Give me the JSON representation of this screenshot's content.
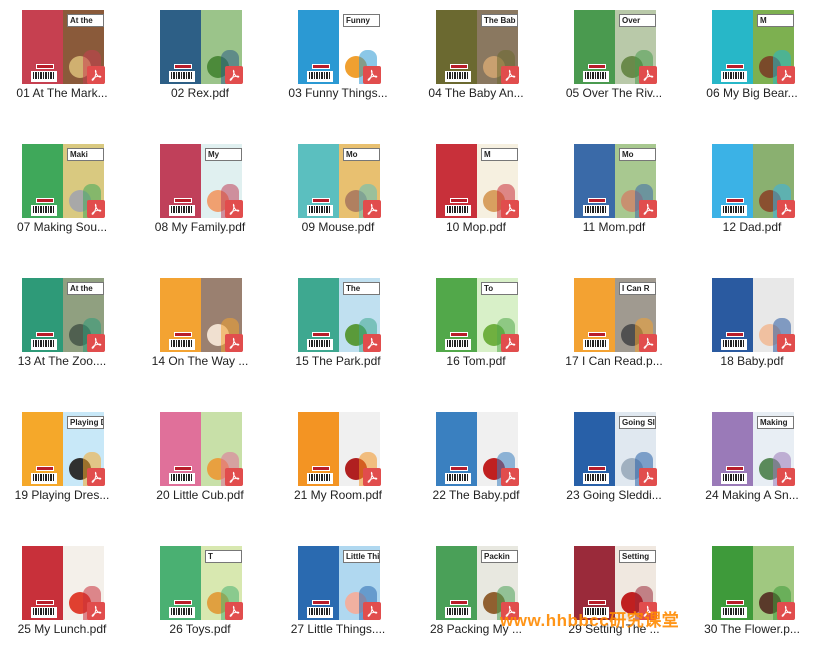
{
  "files": [
    {
      "label": "01 At The Mark...",
      "cover_title": "At the",
      "spine": "#c64050",
      "cover": "#8a5a3a",
      "accent": "#d0b070"
    },
    {
      "label": "02 Rex.pdf",
      "cover_title": "",
      "spine": "#2d5f86",
      "cover": "#9bc48a",
      "accent": "#4c8a3a"
    },
    {
      "label": "03 Funny Things...",
      "cover_title": "Funny",
      "spine": "#2b99d3",
      "cover": "#ffffff",
      "accent": "#f0a030"
    },
    {
      "label": "04 The Baby An...",
      "cover_title": "The Bab",
      "spine": "#6b6930",
      "cover": "#8a7860",
      "accent": "#c9a070"
    },
    {
      "label": "05 Over The Riv...",
      "cover_title": "Over",
      "spine": "#4a9a4f",
      "cover": "#b9c9a9",
      "accent": "#6a8a4a"
    },
    {
      "label": "06 My Big Bear...",
      "cover_title": "M",
      "spine": "#27b7c8",
      "cover": "#7db050",
      "accent": "#7a4a2a"
    },
    {
      "label": "07 Making Sou...",
      "cover_title": "Maki",
      "spine": "#3fa85a",
      "cover": "#d9c980",
      "accent": "#a8a8a8"
    },
    {
      "label": "08 My Family.pdf",
      "cover_title": "My",
      "spine": "#c0405a",
      "cover": "#e0f0f0",
      "accent": "#f0a070"
    },
    {
      "label": "09 Mouse.pdf",
      "cover_title": "Mo",
      "spine": "#5bbfbf",
      "cover": "#e8c070",
      "accent": "#b08060"
    },
    {
      "label": "10 Mop.pdf",
      "cover_title": "M",
      "spine": "#c8303a",
      "cover": "#f6f0e0",
      "accent": "#d8a060"
    },
    {
      "label": "11 Mom.pdf",
      "cover_title": "Mo",
      "spine": "#3a6aa8",
      "cover": "#a8c890",
      "accent": "#c89070"
    },
    {
      "label": "12 Dad.pdf",
      "cover_title": "",
      "spine": "#3bb2e6",
      "cover": "#8ab070",
      "accent": "#8a5030"
    },
    {
      "label": "13 At The Zoo....",
      "cover_title": "At the",
      "spine": "#2e9a78",
      "cover": "#90a080",
      "accent": "#506050"
    },
    {
      "label": "14 On The Way ...",
      "cover_title": "",
      "spine": "#f3a332",
      "cover": "#9a8070",
      "accent": "#f0e0d0"
    },
    {
      "label": "15 The Park.pdf",
      "cover_title": "The",
      "spine": "#3ea890",
      "cover": "#c0e0f0",
      "accent": "#5a9a3a"
    },
    {
      "label": "16 Tom.pdf",
      "cover_title": "To",
      "spine": "#52a84a",
      "cover": "#d8f0c8",
      "accent": "#70b040"
    },
    {
      "label": "17 I Can Read.p...",
      "cover_title": "I Can R",
      "spine": "#f3a232",
      "cover": "#a09a90",
      "accent": "#505050"
    },
    {
      "label": "18 Baby.pdf",
      "cover_title": "",
      "spine": "#2a5aa0",
      "cover": "#e8e8e8",
      "accent": "#f0c0a0"
    },
    {
      "label": "19 Playing Dres...",
      "cover_title": "Playing Dress Up",
      "spine": "#f5a82a",
      "cover": "#c8e8f8",
      "accent": "#303030"
    },
    {
      "label": "20 Little Cub.pdf",
      "cover_title": "",
      "spine": "#e0709a",
      "cover": "#c8e0a8",
      "accent": "#e8a040"
    },
    {
      "label": "21 My Room.pdf",
      "cover_title": "",
      "spine": "#f39423",
      "cover": "#f0f0f0",
      "accent": "#b02020"
    },
    {
      "label": "22 The Baby.pdf",
      "cover_title": "",
      "spine": "#3a80c0",
      "cover": "#f0f0f0",
      "accent": "#c02020"
    },
    {
      "label": "23 Going Sleddi...",
      "cover_title": "Going Sled",
      "spine": "#2860a8",
      "cover": "#e0e8f0",
      "accent": "#a0b0c0"
    },
    {
      "label": "24 Making A Sn...",
      "cover_title": "Making",
      "spine": "#9a7ab8",
      "cover": "#e8eef4",
      "accent": "#5a8a5a"
    },
    {
      "label": "25 My Lunch.pdf",
      "cover_title": "",
      "spine": "#c8303a",
      "cover": "#f4f0ea",
      "accent": "#e04030"
    },
    {
      "label": "26 Toys.pdf",
      "cover_title": "T",
      "spine": "#4ab072",
      "cover": "#d8e8b0",
      "accent": "#e0a040"
    },
    {
      "label": "27 Little Things....",
      "cover_title": "Little Thi",
      "spine": "#2a6ab0",
      "cover": "#b0d8f0",
      "accent": "#f0b0a0"
    },
    {
      "label": "28 Packing My ...",
      "cover_title": "Packin",
      "spine": "#4aa058",
      "cover": "#e8e8e0",
      "accent": "#906030"
    },
    {
      "label": "29 Setting The ...",
      "cover_title": "Setting",
      "spine": "#9a2a3a",
      "cover": "#f0e8e0",
      "accent": "#c02020"
    },
    {
      "label": "30 The Flower.p...",
      "cover_title": "",
      "spine": "#3e9a3a",
      "cover": "#a0c880",
      "accent": "#5a3a2a"
    }
  ],
  "watermark": "www.hhbbcc研究课堂"
}
